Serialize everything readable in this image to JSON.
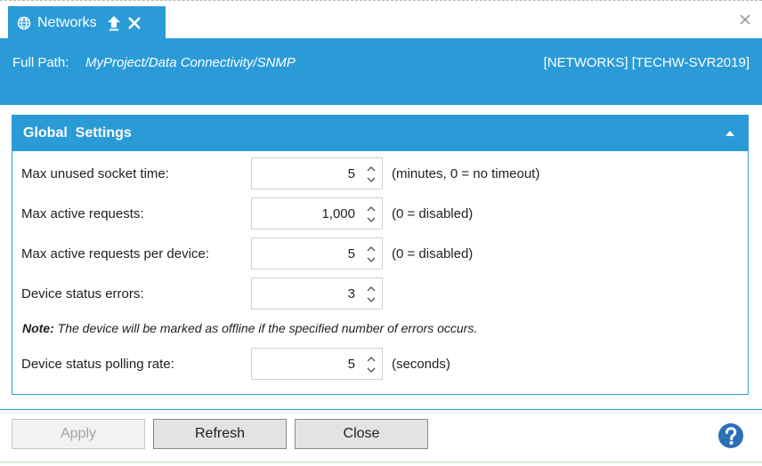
{
  "tab": {
    "title": "Networks",
    "icons": {
      "globe": "globe-icon",
      "pin": "pin-icon",
      "close": "close-icon"
    }
  },
  "window": {
    "close_icon": "close-icon"
  },
  "header": {
    "path_label": "Full Path:",
    "path_value": "MyProject/Data Connectivity/SNMP",
    "server_info": "[NETWORKS] [TECHW-SVR2019]"
  },
  "panel": {
    "title": "Global  Settings",
    "collapse_icon": "chevron-up-icon",
    "fields": [
      {
        "label": "Max unused socket time:",
        "value": "5",
        "hint": "(minutes, 0 = no timeout)"
      },
      {
        "label": "Max active requests:",
        "value": "1,000",
        "hint": "(0 = disabled)"
      },
      {
        "label": "Max active requests per device:",
        "value": "5",
        "hint": "(0 = disabled)"
      },
      {
        "label": "Device status errors:",
        "value": "3",
        "hint": ""
      },
      {
        "label": "Device status polling rate:",
        "value": "5",
        "hint": "(seconds)"
      }
    ],
    "note_bold": "Note:",
    "note_text": " The device will be marked as offline if the specified number of errors occurs."
  },
  "footer": {
    "apply": "Apply",
    "refresh": "Refresh",
    "close": "Close",
    "help_icon": "help-icon"
  },
  "colors": {
    "accent": "#2b9bd8",
    "text": "#1f1f1f",
    "disabled_text": "#a5a5a5"
  }
}
